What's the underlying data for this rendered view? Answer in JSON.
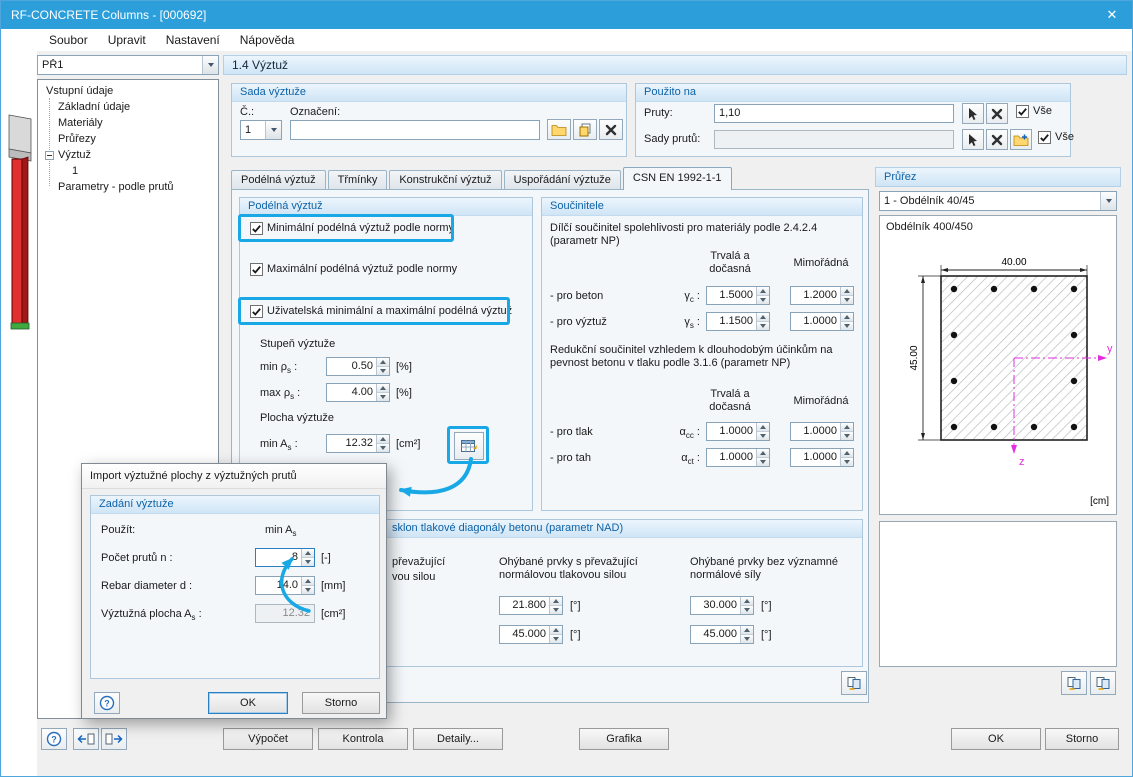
{
  "colors": {
    "titlebar": "#2c9fdb",
    "annotation": "#18a8e6",
    "group-header": "#0e62a6"
  },
  "icons": {
    "close_glyph": "✕",
    "help_glyph": "?"
  },
  "window": {
    "title": "RF-CONCRETE Columns - [000692]"
  },
  "menu": {
    "items": [
      "Soubor",
      "Upravit",
      "Nastavení",
      "Nápověda"
    ]
  },
  "nav": {
    "case": "PŘ1",
    "tree": {
      "root": "Vstupní údaje",
      "items": [
        "Základní údaje",
        "Materiály",
        "Průřezy",
        "Výztuž",
        "1",
        "Parametry - podle prutů"
      ]
    }
  },
  "header": {
    "title": "1.4 Výztuž"
  },
  "reinforcement_set": {
    "title": "Sada výztuže",
    "no_label": "Č.:",
    "no_value": "1",
    "name_label": "Označení:",
    "name_value": ""
  },
  "applied_to": {
    "title": "Použito na",
    "members_label": "Pruty:",
    "members_value": "1,10",
    "sets_label": "Sady prutů:",
    "sets_value": "",
    "all_label": "Vše"
  },
  "tabs": {
    "items": [
      "Podélná výztuž",
      "Třmínky",
      "Konstrukční výztuž",
      "Uspořádání výztuže",
      "CSN EN 1992-1-1"
    ],
    "active": "CSN EN 1992-1-1"
  },
  "longitudinal": {
    "title": "Podélná výztuž",
    "cb_min": "Minimální podélná výztuž podle normy",
    "cb_max": "Maximální podélná výztuž podle normy",
    "cb_user": "Uživatelská minimální a maximální podélná výztuž",
    "ratio_title": "Stupeň výztuže",
    "min_rho": {
      "base": "min ρ",
      "sub": "s",
      "suffix": " :"
    },
    "min_rho_value": "0.50",
    "max_rho": {
      "base": "max ρ",
      "sub": "s",
      "suffix": " :"
    },
    "max_rho_value": "4.00",
    "rho_unit": "[%]",
    "area_title": "Plocha výztuže",
    "min_as": {
      "base": "min A",
      "sub": "s",
      "suffix": " :"
    },
    "min_as_value": "12.32",
    "as_unit": "[cm²]"
  },
  "coefficients": {
    "title": "Součinitele",
    "partial_text": "Dílčí součinitel spolehlivosti pro materiály podle 2.4.2.4 (parametr NP)",
    "reduction_text": "Redukční součinitel vzhledem k dlouhodobým účinkům na pevnost betonu v tlaku podle 3.1.6 (parametr NP)",
    "col1": "Trvalá a dočasná",
    "col2": "Mimořádná",
    "rows": [
      {
        "label": "- pro beton",
        "sym": {
          "base": "γ",
          "sub": "c",
          "suffix": " :"
        },
        "v1": "1.5000",
        "v2": "1.2000"
      },
      {
        "label": "- pro výztuž",
        "sym": {
          "base": "γ",
          "sub": "s",
          "suffix": " :"
        },
        "v1": "1.1500",
        "v2": "1.0000"
      },
      {
        "label": "- pro tlak",
        "sym": {
          "base": "α",
          "sub": "cc",
          "suffix": " :"
        },
        "v1": "1.0000",
        "v2": "1.0000"
      },
      {
        "label": "- pro tah",
        "sym": {
          "base": "α",
          "sub": "ct",
          "suffix": " :"
        },
        "v1": "1.0000",
        "v2": "1.0000"
      }
    ]
  },
  "strut": {
    "title_visible": "sklon tlakové diagonály betonu (parametr NAD)",
    "col_left_line1": "převažující",
    "col_left_line2": "vou silou",
    "col_mid": "Ohýbané prvky s převažující normálovou tlakovou silou",
    "col_right": "Ohýbané prvky bez významné normálové síly",
    "deg_unit": "[°]",
    "mid_v1": "21.800",
    "mid_v2": "45.000",
    "right_v1": "30.000",
    "right_v2": "45.000"
  },
  "section_panel": {
    "title": "Průřez",
    "dropdown": "1 - Obdélník 40/45",
    "caption": "Obdélník 400/450",
    "dim_w": "40.00",
    "dim_h": "45.00",
    "axis_y": "y",
    "axis_z": "z",
    "unit": "[cm]"
  },
  "import_dialog": {
    "title": "Import výztužné plochy z výztužných prutů",
    "group": "Zadání výztuže",
    "use_label": "Použít:",
    "use_value": {
      "base": "min A",
      "sub": "s",
      "suffix": ""
    },
    "bars_label": "Počet prutů n :",
    "bars_value": "8",
    "bars_unit": "[-]",
    "dia_label": "Rebar diameter d :",
    "dia_value": "14.0",
    "dia_unit": "[mm]",
    "area_label": {
      "base": "Výztužná plocha A",
      "sub": "s",
      "suffix": " :"
    },
    "area_value": "12.32",
    "area_unit": "[cm²]",
    "ok": "OK",
    "cancel": "Storno"
  },
  "footer": {
    "calc": "Výpočet",
    "check": "Kontrola",
    "details": "Detaily...",
    "graphics": "Grafika",
    "ok": "OK",
    "cancel": "Storno"
  }
}
